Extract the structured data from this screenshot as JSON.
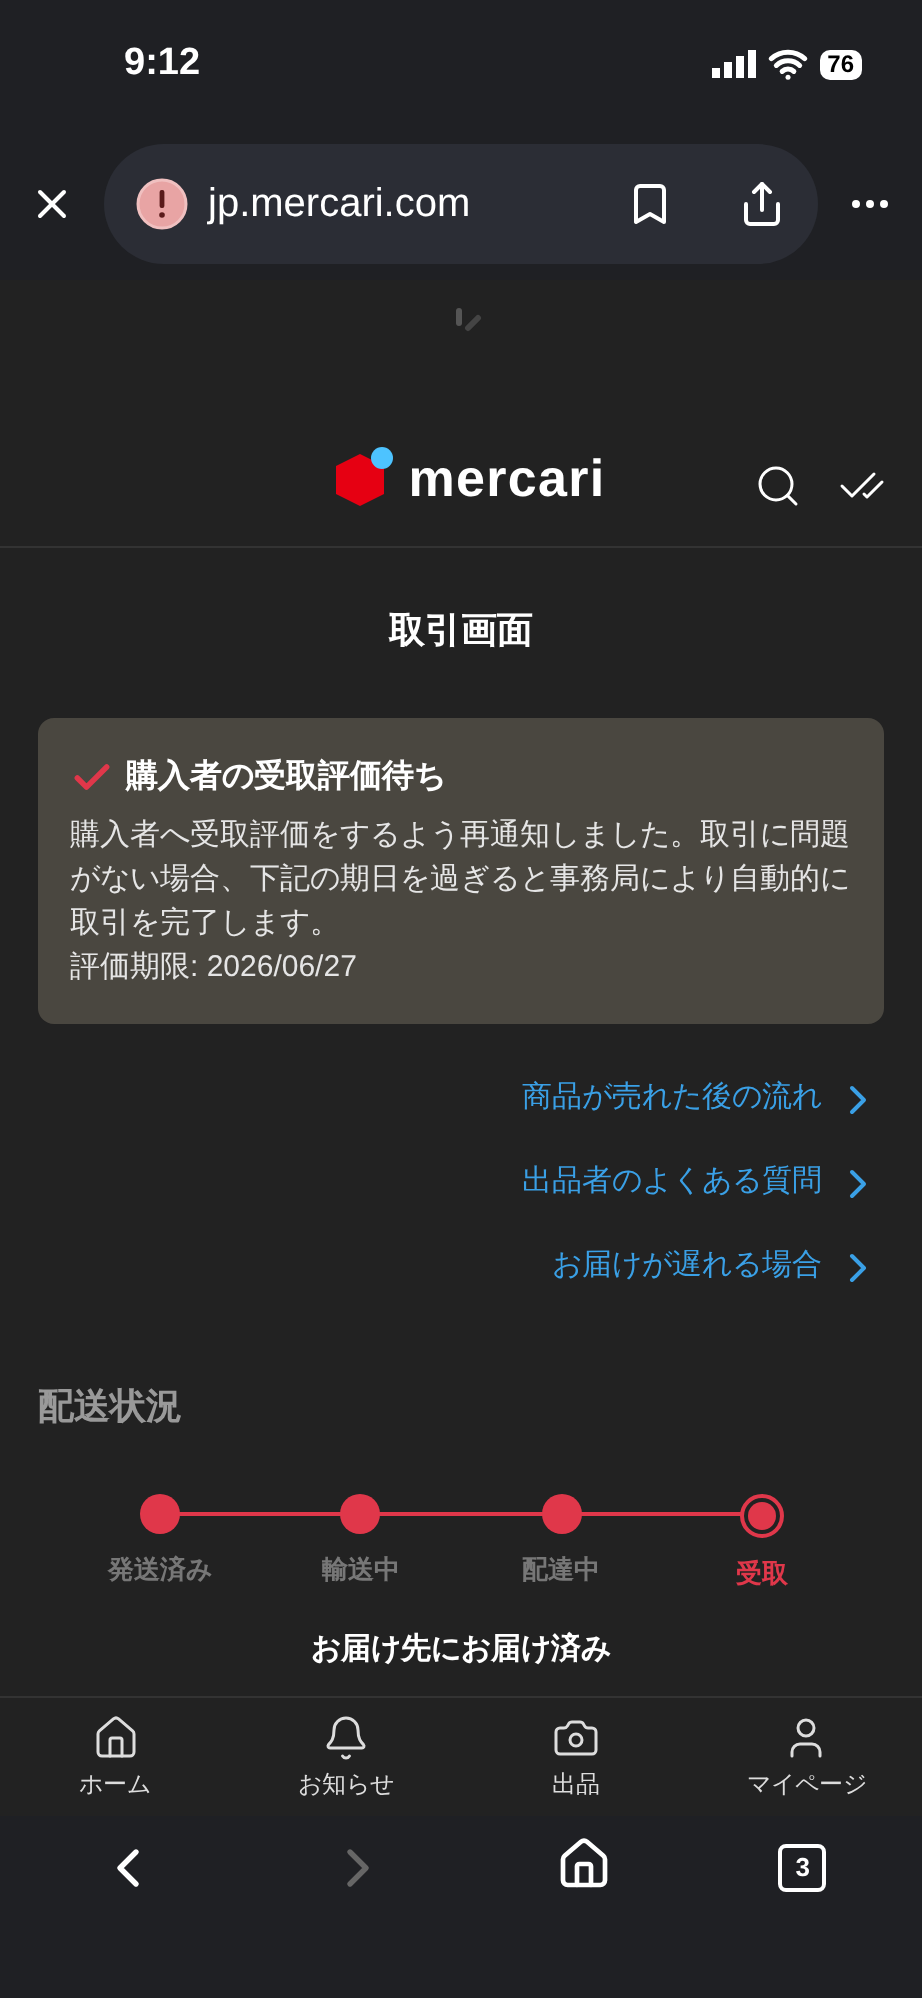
{
  "status_bar": {
    "time": "9:12",
    "battery": "76"
  },
  "browser": {
    "url": "jp.mercari.com",
    "tabs_count": "3",
    "forward_disabled": true
  },
  "header": {
    "logo_text": "mercari"
  },
  "page_title": "取引画面",
  "notice": {
    "title": "購入者の受取評価待ち",
    "body": "購入者へ受取評価をするよう再通知しました。取引に問題がない場合、下記の期日を過ぎると事務局により自動的に取引を完了します。",
    "deadline": "評価期限: 2026/06/27"
  },
  "links": [
    "商品が売れた後の流れ",
    "出品者のよくある質問",
    "お届けが遅れる場合"
  ],
  "shipping": {
    "title": "配送状況",
    "steps": [
      {
        "label": "発送済み",
        "selected": false
      },
      {
        "label": "輸送中",
        "selected": false
      },
      {
        "label": "配達中",
        "selected": false
      },
      {
        "label": "受取",
        "selected": true
      }
    ],
    "status": "お届け先にお届け済み"
  },
  "bottom_nav": [
    {
      "label": "ホーム"
    },
    {
      "label": "お知らせ"
    },
    {
      "label": "出品"
    },
    {
      "label": "マイページ"
    }
  ]
}
